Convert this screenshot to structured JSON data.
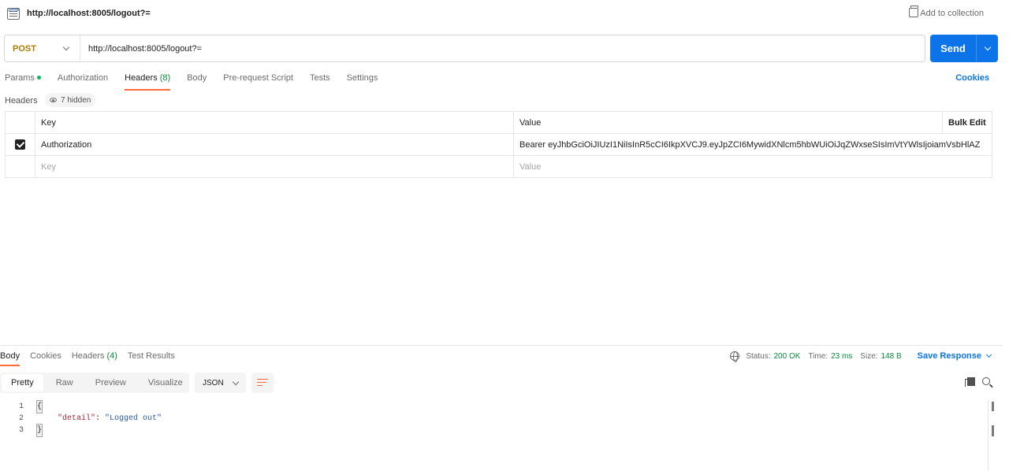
{
  "title_bar": {
    "request_title": "http://localhost:8005/logout?=",
    "add_to_collection": "Add to collection",
    "http_icon": "HTTP"
  },
  "url_bar": {
    "method": "POST",
    "url": "http://localhost:8005/logout?=",
    "send_label": "Send"
  },
  "request_tabs": {
    "params": "Params",
    "authorization": "Authorization",
    "headers": "Headers",
    "headers_count": "(8)",
    "body": "Body",
    "pre_request": "Pre-request Script",
    "tests": "Tests",
    "settings": "Settings",
    "active": "Headers",
    "cookies": "Cookies"
  },
  "headers_section": {
    "label": "Headers",
    "hidden_toggle": "7 hidden",
    "columns": {
      "key": "Key",
      "value": "Value",
      "bulk_edit": "Bulk Edit"
    },
    "rows": [
      {
        "checked": true,
        "key": "Authorization",
        "value": "Bearer eyJhbGciOiJIUzI1NiIsInR5cCI6IkpXVCJ9.eyJpZCI6MywidXNlcm5hbWUiOiJqZWxseSIsImVtYWlsIjoiamVsbHlAZ"
      }
    ],
    "new_row": {
      "key_placeholder": "Key",
      "value_placeholder": "Value"
    }
  },
  "response": {
    "tabs": {
      "body": "Body",
      "cookies": "Cookies",
      "headers": "Headers",
      "headers_count": "(4)",
      "test_results": "Test Results",
      "active": "Body"
    },
    "status": {
      "status_label": "Status:",
      "status_value": "200 OK",
      "time_label": "Time:",
      "time_value": "23 ms",
      "size_label": "Size:",
      "size_value": "148 B",
      "save_response": "Save Response"
    },
    "view_modes": [
      "Pretty",
      "Raw",
      "Preview",
      "Visualize"
    ],
    "active_view_mode": "Pretty",
    "format": "JSON",
    "code_lines": [
      {
        "n": "1",
        "brace": "{"
      },
      {
        "n": "2",
        "key": "\"detail\"",
        "colon": ": ",
        "value": "\"Logged out\""
      },
      {
        "n": "3",
        "brace": "}"
      }
    ]
  },
  "colors": {
    "accent": "#ff6c37",
    "send_blue": "#0c73e8",
    "method_post": "#ad7a03",
    "status_ok": "#0c8a3e"
  },
  "icons": [
    "http-icon",
    "add-collection-icon",
    "chevron-down-icon",
    "eye-icon",
    "checkbox-icon",
    "globe-icon",
    "wrap-lines-icon",
    "copy-icon",
    "search-icon"
  ]
}
